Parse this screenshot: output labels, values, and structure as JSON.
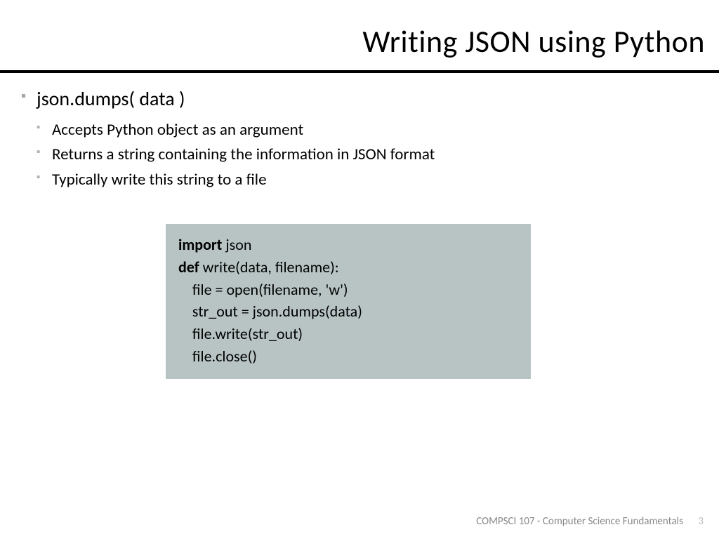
{
  "title": "Writing JSON using Python",
  "main_bullet": "json.dumps( data )",
  "sub_bullets": [
    "Accepts Python object as an argument",
    "Returns a string containing the information in JSON format",
    "Typically write this string to a file"
  ],
  "code": {
    "l1_kw": "import",
    "l1_rest": " json",
    "l2_kw": "def",
    "l2_rest": " write(data, filename):",
    "l3": "    file = open(filename, 'w')",
    "l4": "    str_out = json.dumps(data)",
    "l5": "    file.write(str_out)",
    "l6": "    file.close()"
  },
  "footer": {
    "course": "COMPSCI 107 - Computer Science Fundamentals",
    "page": "3"
  }
}
